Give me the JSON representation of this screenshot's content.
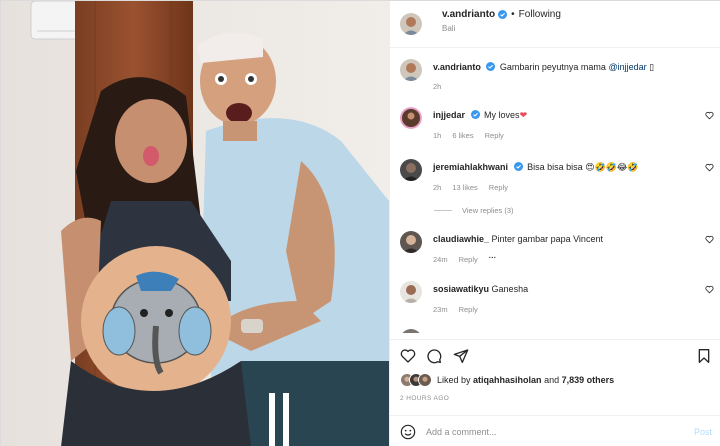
{
  "header": {
    "username": "v.andrianto",
    "separator": "•",
    "follow_label": "Following",
    "location": "Bali"
  },
  "comments": [
    {
      "username": "v.andrianto",
      "text": "Gambarin peyutnya mama ",
      "mention": "@injjedar",
      "emoji": "▯",
      "time": "2h"
    },
    {
      "username": "injjedar",
      "text": "My loves",
      "emoji": "❤",
      "time": "1h",
      "likes": "6 likes",
      "reply": "Reply"
    },
    {
      "username": "jeremiahlakhwani",
      "text": "Bisa bisa bisa ",
      "emoji": "😍🤣🤣😂🤣",
      "time": "2h",
      "likes": "13 likes",
      "reply": "Reply",
      "view_replies": "View replies (3)"
    },
    {
      "username": "claudiawhie_",
      "text": "Pinter gambar papa Vincent",
      "time": "24m",
      "reply": "Reply",
      "more": "···"
    },
    {
      "username": "sosiawatikyu",
      "text": "Ganesha",
      "time": "23m",
      "reply": "Reply"
    }
  ],
  "likes": {
    "prefix": "Liked by ",
    "user": "atiqahhasiholan",
    "middle": " and ",
    "count": "7,839 others"
  },
  "timestamp": "2 HOURS AGO",
  "add_comment": {
    "placeholder": "Add a comment...",
    "post_label": "Post"
  },
  "colors": {
    "verified": "#3897f0",
    "heart": "#ed4956",
    "link": "#00376b",
    "post_disabled": "#b2dffc"
  },
  "icons": [
    "verified-badge-icon",
    "heart-icon",
    "comment-icon",
    "share-icon",
    "bookmark-icon",
    "emoji-icon",
    "like-heart-icon"
  ]
}
